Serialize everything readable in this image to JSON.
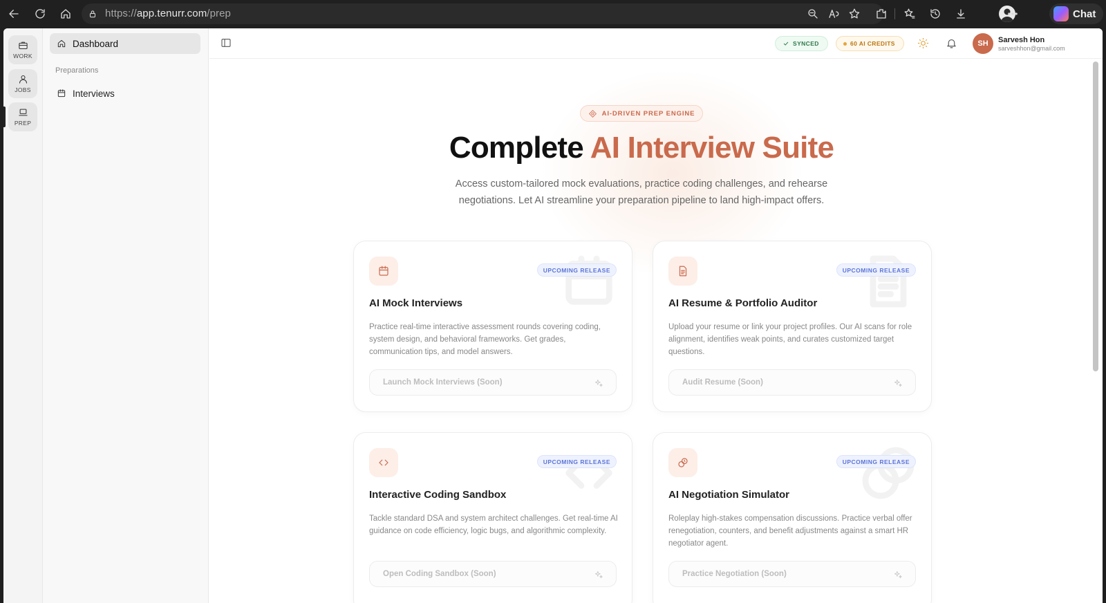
{
  "browser": {
    "url_prefix": "https://",
    "url_host": "app.tenurr.com",
    "url_path": "/prep",
    "chat_label": "Chat"
  },
  "rail": {
    "items": [
      {
        "label": "WORK",
        "icon": "briefcase-icon"
      },
      {
        "label": "JOBS",
        "icon": "user-icon"
      },
      {
        "label": "PREP",
        "icon": "laptop-icon"
      }
    ]
  },
  "sidebar": {
    "dashboard": "Dashboard",
    "section": "Preparations",
    "interviews": "Interviews"
  },
  "topbar": {
    "synced": "SYNCED",
    "credits": "60 AI CREDITS",
    "avatar_initials": "SH",
    "user_name": "Sarvesh Hon",
    "user_email": "sarveshhon@gmail.com"
  },
  "hero": {
    "pill": "AI-DRIVEN PREP ENGINE",
    "title_main": "Complete ",
    "title_accent": "AI Interview Suite",
    "subtitle": "Access custom-tailored mock evaluations, practice coding challenges, and rehearse negotiations. Let AI streamline your preparation pipeline to land high-impact offers."
  },
  "cards": [
    {
      "badge": "UPCOMING RELEASE",
      "title": "AI Mock Interviews",
      "desc": "Practice real-time interactive assessment rounds covering coding, system design, and behavioral frameworks. Get grades, communication tips, and model answers.",
      "button": "Launch Mock Interviews (Soon)",
      "icon": "calendar-icon"
    },
    {
      "badge": "UPCOMING RELEASE",
      "title": "AI Resume & Portfolio Auditor",
      "desc": "Upload your resume or link your project profiles. Our AI scans for role alignment, identifies weak points, and curates customized target questions.",
      "button": "Audit Resume (Soon)",
      "icon": "document-icon"
    },
    {
      "badge": "UPCOMING RELEASE",
      "title": "Interactive Coding Sandbox",
      "desc": "Tackle standard DSA and system architect challenges. Get real-time AI guidance on code efficiency, logic bugs, and algorithmic complexity.",
      "button": "Open Coding Sandbox (Soon)",
      "icon": "code-icon"
    },
    {
      "badge": "UPCOMING RELEASE",
      "title": "AI Negotiation Simulator",
      "desc": "Roleplay high-stakes compensation discussions. Practice verbal offer renegotiation, counters, and benefit adjustments against a smart HR negotiator agent.",
      "button": "Practice Negotiation (Soon)",
      "icon": "coins-icon"
    }
  ],
  "colors": {
    "accent": "#c96a4c",
    "badge_blue": "#5b74d6",
    "synced_green": "#2f7a4a",
    "credits_amber": "#b97611"
  }
}
